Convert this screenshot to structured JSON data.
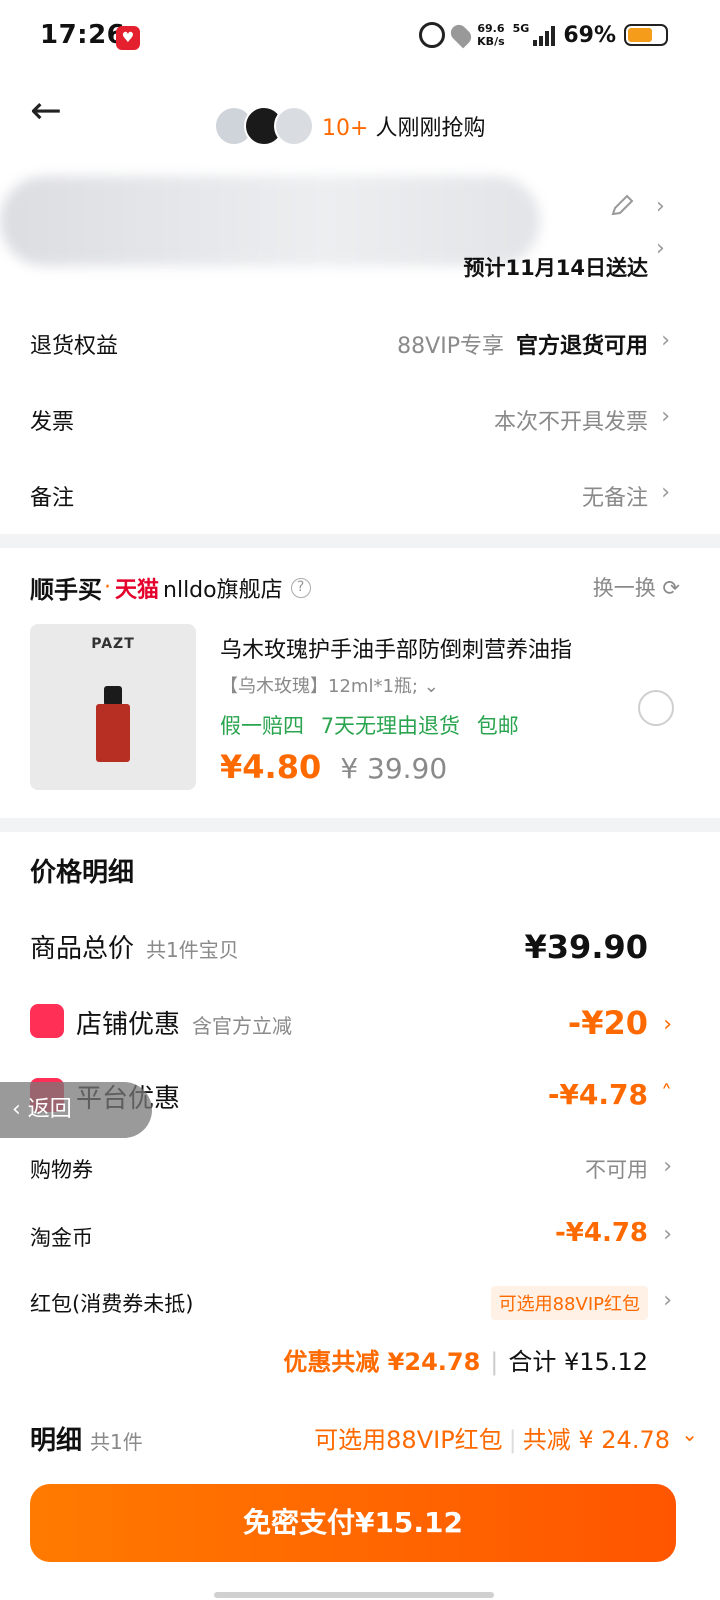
{
  "status": {
    "time": "17:26",
    "speed_top": "69.6",
    "speed_bottom": "KB/s",
    "network": "5G",
    "battery": "69%"
  },
  "header": {
    "buyers_count": "10+",
    "buyers_text": "人刚刚抢购"
  },
  "address": {
    "delivery": "预计11月14日送达"
  },
  "rows": [
    {
      "label": "退货权益",
      "value": "88VIP专享",
      "value_strong": "官方退货可用"
    },
    {
      "label": "发票",
      "value": "本次不开具发票"
    },
    {
      "label": "备注",
      "value": "无备注"
    }
  ],
  "shop": {
    "brand1": "顺手买",
    "dot": "·",
    "brand2": "天猫",
    "name": "nlldo旗舰店",
    "swap": "换一换",
    "product": {
      "brand_on_image": "PAZT",
      "title": "乌木玫瑰护手油手部防倒刺营养油指",
      "spec": "【乌木玫瑰】12ml*1瓶;",
      "tags": [
        "假一赔四",
        "7天无理由退货",
        "包邮"
      ],
      "price": "¥4.80",
      "orig_price": "¥ 39.90"
    }
  },
  "detail": {
    "title": "价格明细",
    "total_label": "商品总价",
    "total_sub": "共1件宝贝",
    "total_value": "¥39.90",
    "shop_disc_label": "店铺优惠",
    "shop_disc_sub": "含官方立减",
    "shop_disc_value": "-¥20",
    "platform_label": "平台优惠",
    "platform_value": "-¥4.78",
    "coupon_label": "购物券",
    "coupon_value": "不可用",
    "coin_label": "淘金币",
    "coin_value": "-¥4.78",
    "redpack_label": "红包(消费券未抵)",
    "redpack_value": "可选用88VIP红包",
    "discount_total": "优惠共减 ¥24.78",
    "total": "合计 ¥15.12",
    "bottom_label": "明细",
    "bottom_sub": "共1件",
    "bottom_vip": "可选用88VIP红包",
    "bottom_saved": "共减 ¥ 24.78",
    "pay_label": "免密支付¥15.12"
  },
  "float_back": "返回"
}
